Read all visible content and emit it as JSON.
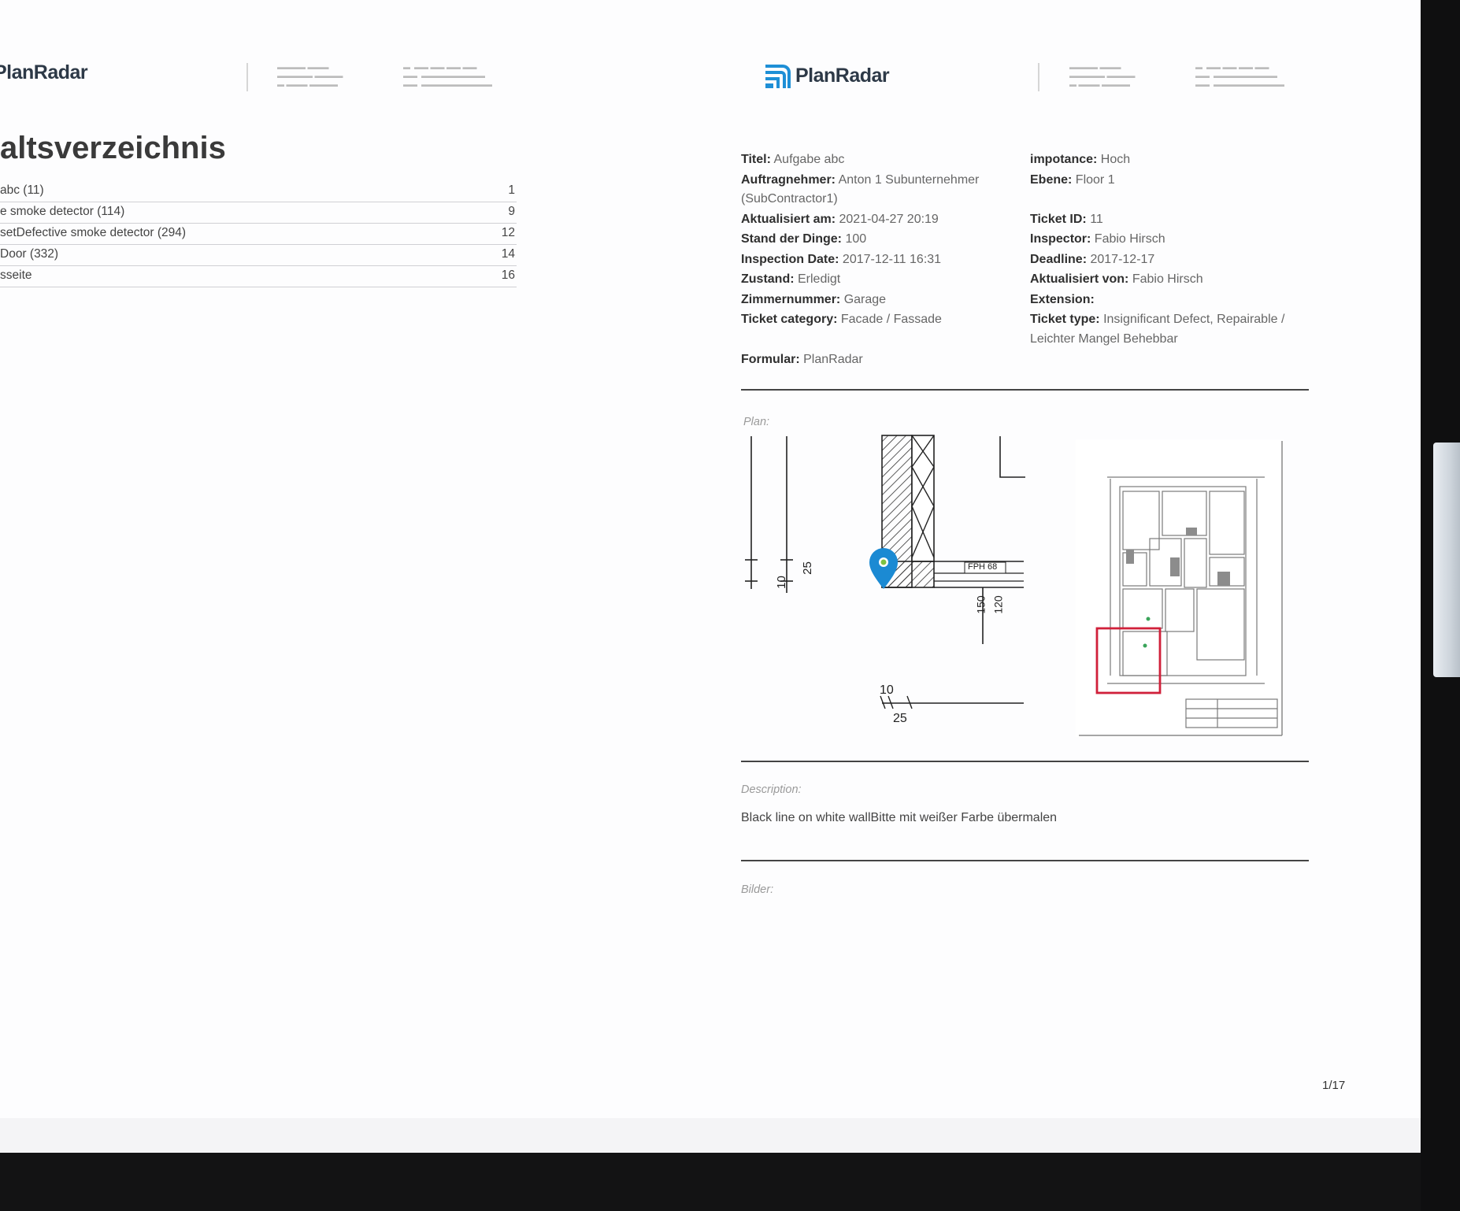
{
  "brand": {
    "name": "PlanRadar"
  },
  "toc": {
    "title": "altsverzeichnis",
    "items": [
      {
        "label": "abc (11)",
        "page": "1"
      },
      {
        "label": "e smoke detector (114)",
        "page": "9"
      },
      {
        "label": "setDefective smoke detector (294)",
        "page": "12"
      },
      {
        "label": "Door (332)",
        "page": "14"
      },
      {
        "label": "sseite",
        "page": "16"
      }
    ]
  },
  "ticket": {
    "left": [
      {
        "label": "Titel:",
        "value": "Aufgabe abc"
      },
      {
        "label": "Auftragnehmer:",
        "value": "Anton 1 Subunternehmer"
      },
      {
        "label": "",
        "value": "(SubContractor1)"
      },
      {
        "label": "Aktualisiert am:",
        "value": "2021-04-27 20:19"
      },
      {
        "label": "Stand der Dinge:",
        "value": "100"
      },
      {
        "label": "Inspection Date:",
        "value": "2017-12-11 16:31"
      },
      {
        "label": "Zustand:",
        "value": "Erledigt"
      },
      {
        "label": "Zimmernummer:",
        "value": "Garage"
      },
      {
        "label": "Ticket category:",
        "value": "Facade / Fassade"
      }
    ],
    "right": [
      {
        "label": "impotance:",
        "value": "Hoch"
      },
      {
        "label": "Ebene:",
        "value": "Floor 1"
      },
      {
        "label": "",
        "value": ""
      },
      {
        "label": "Ticket ID:",
        "value": "11"
      },
      {
        "label": "Inspector:",
        "value": "Fabio Hirsch"
      },
      {
        "label": "Deadline:",
        "value": "2017-12-17"
      },
      {
        "label": "Aktualisiert von:",
        "value": "Fabio Hirsch"
      },
      {
        "label": "Extension:",
        "value": ""
      },
      {
        "label": "Ticket type:",
        "value": "Insignificant Defect, Repairable /"
      },
      {
        "label": "",
        "value": "Leichter Mangel Behebbar"
      }
    ],
    "formular": {
      "label": "Formular:",
      "value": "PlanRadar"
    }
  },
  "plan": {
    "label": "Plan:",
    "dims": {
      "d10a": "10",
      "d25a": "25",
      "d150": "150",
      "d120": "120",
      "d10b": "10",
      "d25b": "25",
      "fph": "FPH 68"
    }
  },
  "description": {
    "label": "Description:",
    "text": "Black line on white wallBitte mit weißer Farbe übermalen"
  },
  "images": {
    "label": "Bilder:"
  },
  "page_number": "1/17",
  "colors": {
    "brand_dark": "#2d3947",
    "brand_blue": "#1e8fd6",
    "marker_blue": "#1b8ad3",
    "highlight_red": "#d0203a"
  }
}
